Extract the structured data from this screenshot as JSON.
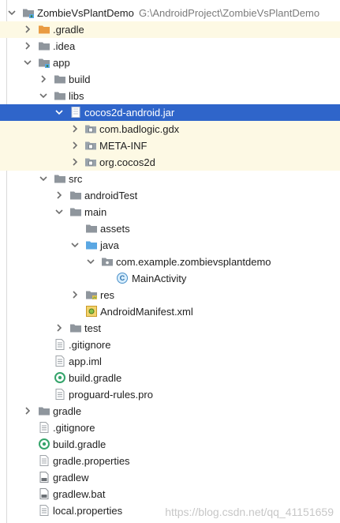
{
  "project": {
    "name": "ZombieVsPlantDemo",
    "path": "G:\\AndroidProject\\ZombieVsPlantDemo"
  },
  "items": [
    {
      "label": ".gradle"
    },
    {
      "label": ".idea"
    },
    {
      "label": "app"
    },
    {
      "label": "build"
    },
    {
      "label": "libs"
    },
    {
      "label": "cocos2d-android.jar"
    },
    {
      "label": "com.badlogic.gdx"
    },
    {
      "label": "META-INF"
    },
    {
      "label": "org.cocos2d"
    },
    {
      "label": "src"
    },
    {
      "label": "androidTest"
    },
    {
      "label": "main"
    },
    {
      "label": "assets"
    },
    {
      "label": "java"
    },
    {
      "label": "com.example.zombievsplantdemo"
    },
    {
      "label": "MainActivity"
    },
    {
      "label": "res"
    },
    {
      "label": "AndroidManifest.xml"
    },
    {
      "label": "test"
    },
    {
      "label": ".gitignore"
    },
    {
      "label": "app.iml"
    },
    {
      "label": "build.gradle"
    },
    {
      "label": "proguard-rules.pro"
    },
    {
      "label": "gradle"
    },
    {
      "label": ".gitignore"
    },
    {
      "label": "build.gradle"
    },
    {
      "label": "gradle.properties"
    },
    {
      "label": "gradlew"
    },
    {
      "label": "gradlew.bat"
    },
    {
      "label": "local.properties"
    }
  ],
  "watermark": "https://blog.csdn.net/qq_41151659",
  "colors": {
    "selection": "#2f65ca",
    "highlight_row": "#fdf9e4",
    "folder": "#8f969d",
    "excluded_folder": "#e99b42",
    "source_folder": "#5aa7e3"
  }
}
